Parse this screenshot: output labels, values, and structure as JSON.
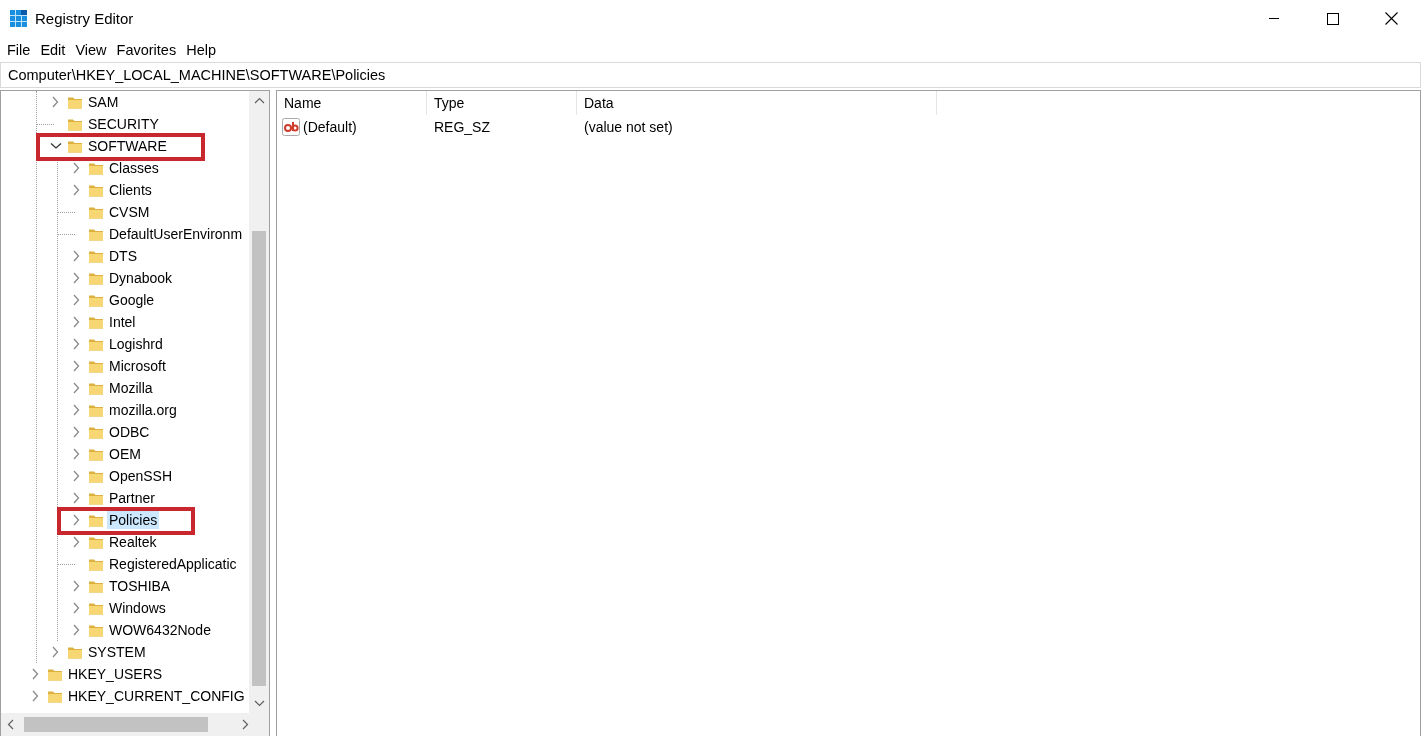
{
  "window": {
    "title": "Registry Editor"
  },
  "menu": [
    {
      "label": "File"
    },
    {
      "label": "Edit"
    },
    {
      "label": "View"
    },
    {
      "label": "Favorites"
    },
    {
      "label": "Help"
    }
  ],
  "address_bar": {
    "value": "Computer\\HKEY_LOCAL_MACHINE\\SOFTWARE\\Policies"
  },
  "tree": {
    "items": [
      {
        "expanded": true,
        "children": [
          {
            "label": "SAM",
            "expandable": true,
            "expanded": false,
            "selected": false,
            "outlined": false
          },
          {
            "label": "SECURITY",
            "expandable": false,
            "selected": false,
            "outlined": false
          },
          {
            "label": "SOFTWARE",
            "expandable": true,
            "expanded": true,
            "selected": false,
            "outlined": true,
            "children": [
              {
                "label": "Classes",
                "expandable": true,
                "expanded": false,
                "selected": false,
                "outlined": false
              },
              {
                "label": "Clients",
                "expandable": true,
                "expanded": false,
                "selected": false,
                "outlined": false
              },
              {
                "label": "CVSM",
                "expandable": false,
                "selected": false,
                "outlined": false
              },
              {
                "label": "DefaultUserEnvironm",
                "expandable": false,
                "selected": false,
                "outlined": false
              },
              {
                "label": "DTS",
                "expandable": true,
                "expanded": false,
                "selected": false,
                "outlined": false
              },
              {
                "label": "Dynabook",
                "expandable": true,
                "expanded": false,
                "selected": false,
                "outlined": false
              },
              {
                "label": "Google",
                "expandable": true,
                "expanded": false,
                "selected": false,
                "outlined": false
              },
              {
                "label": "Intel",
                "expandable": true,
                "expanded": false,
                "selected": false,
                "outlined": false
              },
              {
                "label": "Logishrd",
                "expandable": true,
                "expanded": false,
                "selected": false,
                "outlined": false
              },
              {
                "label": "Microsoft",
                "expandable": true,
                "expanded": false,
                "selected": false,
                "outlined": false
              },
              {
                "label": "Mozilla",
                "expandable": true,
                "expanded": false,
                "selected": false,
                "outlined": false
              },
              {
                "label": "mozilla.org",
                "expandable": true,
                "expanded": false,
                "selected": false,
                "outlined": false
              },
              {
                "label": "ODBC",
                "expandable": true,
                "expanded": false,
                "selected": false,
                "outlined": false
              },
              {
                "label": "OEM",
                "expandable": true,
                "expanded": false,
                "selected": false,
                "outlined": false
              },
              {
                "label": "OpenSSH",
                "expandable": true,
                "expanded": false,
                "selected": false,
                "outlined": false
              },
              {
                "label": "Partner",
                "expandable": true,
                "expanded": false,
                "selected": false,
                "outlined": false
              },
              {
                "label": "Policies",
                "expandable": true,
                "expanded": false,
                "selected": true,
                "outlined": true
              },
              {
                "label": "Realtek",
                "expandable": true,
                "expanded": false,
                "selected": false,
                "outlined": false
              },
              {
                "label": "RegisteredApplicatic",
                "expandable": false,
                "selected": false,
                "outlined": false
              },
              {
                "label": "TOSHIBA",
                "expandable": true,
                "expanded": false,
                "selected": false,
                "outlined": false
              },
              {
                "label": "Windows",
                "expandable": true,
                "expanded": false,
                "selected": false,
                "outlined": false
              },
              {
                "label": "WOW6432Node",
                "expandable": true,
                "expanded": false,
                "selected": false,
                "outlined": false
              }
            ]
          },
          {
            "label": "SYSTEM",
            "expandable": true,
            "expanded": false,
            "selected": false,
            "outlined": false
          }
        ]
      },
      {
        "label": "HKEY_USERS",
        "expandable": true,
        "expanded": false,
        "selected": false,
        "outlined": false
      },
      {
        "label": "HKEY_CURRENT_CONFIG",
        "expandable": true,
        "expanded": false,
        "selected": false,
        "outlined": false
      }
    ]
  },
  "values_list": {
    "columns": [
      "Name",
      "Type",
      "Data"
    ],
    "rows": [
      {
        "kind": "string",
        "name": "(Default)",
        "type": "REG_SZ",
        "data": "(value not set)"
      }
    ]
  }
}
